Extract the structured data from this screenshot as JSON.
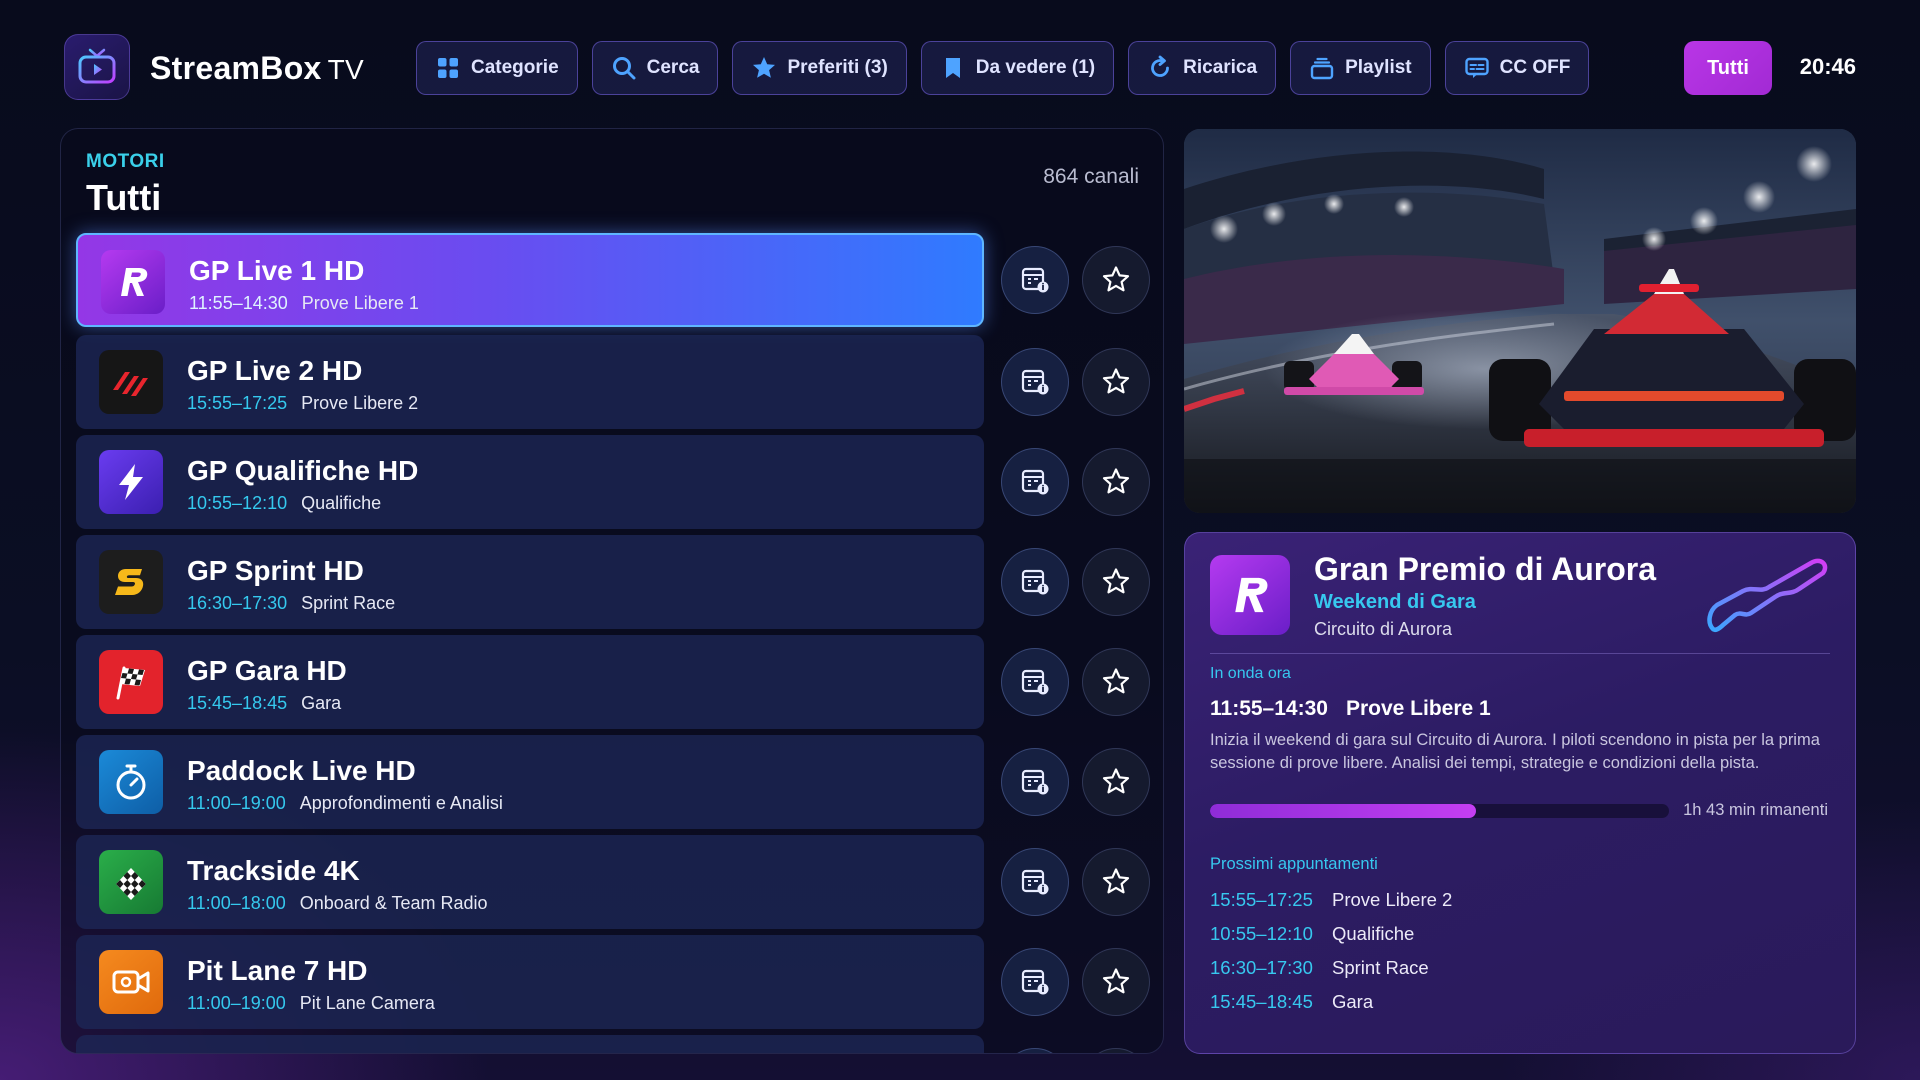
{
  "app": {
    "brand": "StreamBox",
    "brand_suffix": "TV",
    "clock": "20:46",
    "filter_label": "Tutti"
  },
  "nav": [
    {
      "label": "Categorie",
      "icon": "grid-icon"
    },
    {
      "label": "Cerca",
      "icon": "search-icon"
    },
    {
      "label": "Preferiti (3)",
      "icon": "star-icon"
    },
    {
      "label": "Da vedere (1)",
      "icon": "bookmark-icon"
    },
    {
      "label": "Ricarica",
      "icon": "refresh-icon"
    },
    {
      "label": "Playlist",
      "icon": "playlist-icon"
    },
    {
      "label": "CC OFF",
      "icon": "captions-icon"
    }
  ],
  "list": {
    "category": "MOTORI",
    "title": "Tutti",
    "count": "864 canali",
    "channels": [
      {
        "name": "GP Live 1 HD",
        "time": "11:55–14:30",
        "program": "Prove Libere 1",
        "icon": "r-logo-icon",
        "color": "#8a2be2",
        "active": true
      },
      {
        "name": "GP Live 2 HD",
        "time": "15:55–17:25",
        "program": "Prove Libere 2",
        "icon": "stripes-icon",
        "color": "#1a1a1a"
      },
      {
        "name": "GP Qualifiche HD",
        "time": "10:55–12:10",
        "program": "Qualifiche",
        "icon": "lightning-icon",
        "color": "#5a2ad0"
      },
      {
        "name": "GP Sprint HD",
        "time": "16:30–17:30",
        "program": "Sprint Race",
        "icon": "s-logo-icon",
        "color": "#222222"
      },
      {
        "name": "GP Gara HD",
        "time": "15:45–18:45",
        "program": "Gara",
        "icon": "checkered-flag-icon",
        "color": "#e0202a"
      },
      {
        "name": "Paddock Live HD",
        "time": "11:00–19:00",
        "program": "Approfondimenti e Analisi",
        "icon": "stopwatch-icon",
        "color": "#1577c9"
      },
      {
        "name": "Trackside 4K",
        "time": "11:00–18:00",
        "program": "Onboard & Team Radio",
        "icon": "checkered-flag-icon",
        "color": "#1e9a3e"
      },
      {
        "name": "Pit Lane 7 HD",
        "time": "11:00–19:00",
        "program": "Pit Lane Camera",
        "icon": "camera-icon",
        "color": "#ef7a14"
      }
    ]
  },
  "detail": {
    "title": "Gran Premio di Aurora",
    "subtitle": "Weekend di Gara",
    "circuit": "Circuito di Aurora",
    "on_air_label": "In onda ora",
    "now_time": "11:55–14:30",
    "now_program": "Prove Libere 1",
    "description": "Inizia il weekend di gara sul Circuito di Aurora. I piloti scendono in pista per la prima sessione di prove libere. Analisi dei tempi, strategie e condizioni della pista.",
    "progress": 0.58,
    "remaining": "1h 43 min rimanenti",
    "next_label": "Prossimi appuntamenti",
    "next": [
      {
        "time": "15:55–17:25",
        "program": "Prove Libere 2"
      },
      {
        "time": "10:55–12:10",
        "program": "Qualifiche"
      },
      {
        "time": "16:30–17:30",
        "program": "Sprint Race"
      },
      {
        "time": "15:45–18:45",
        "program": "Gara"
      }
    ]
  },
  "preview": {
    "subject": "race-cars-night-rain"
  }
}
